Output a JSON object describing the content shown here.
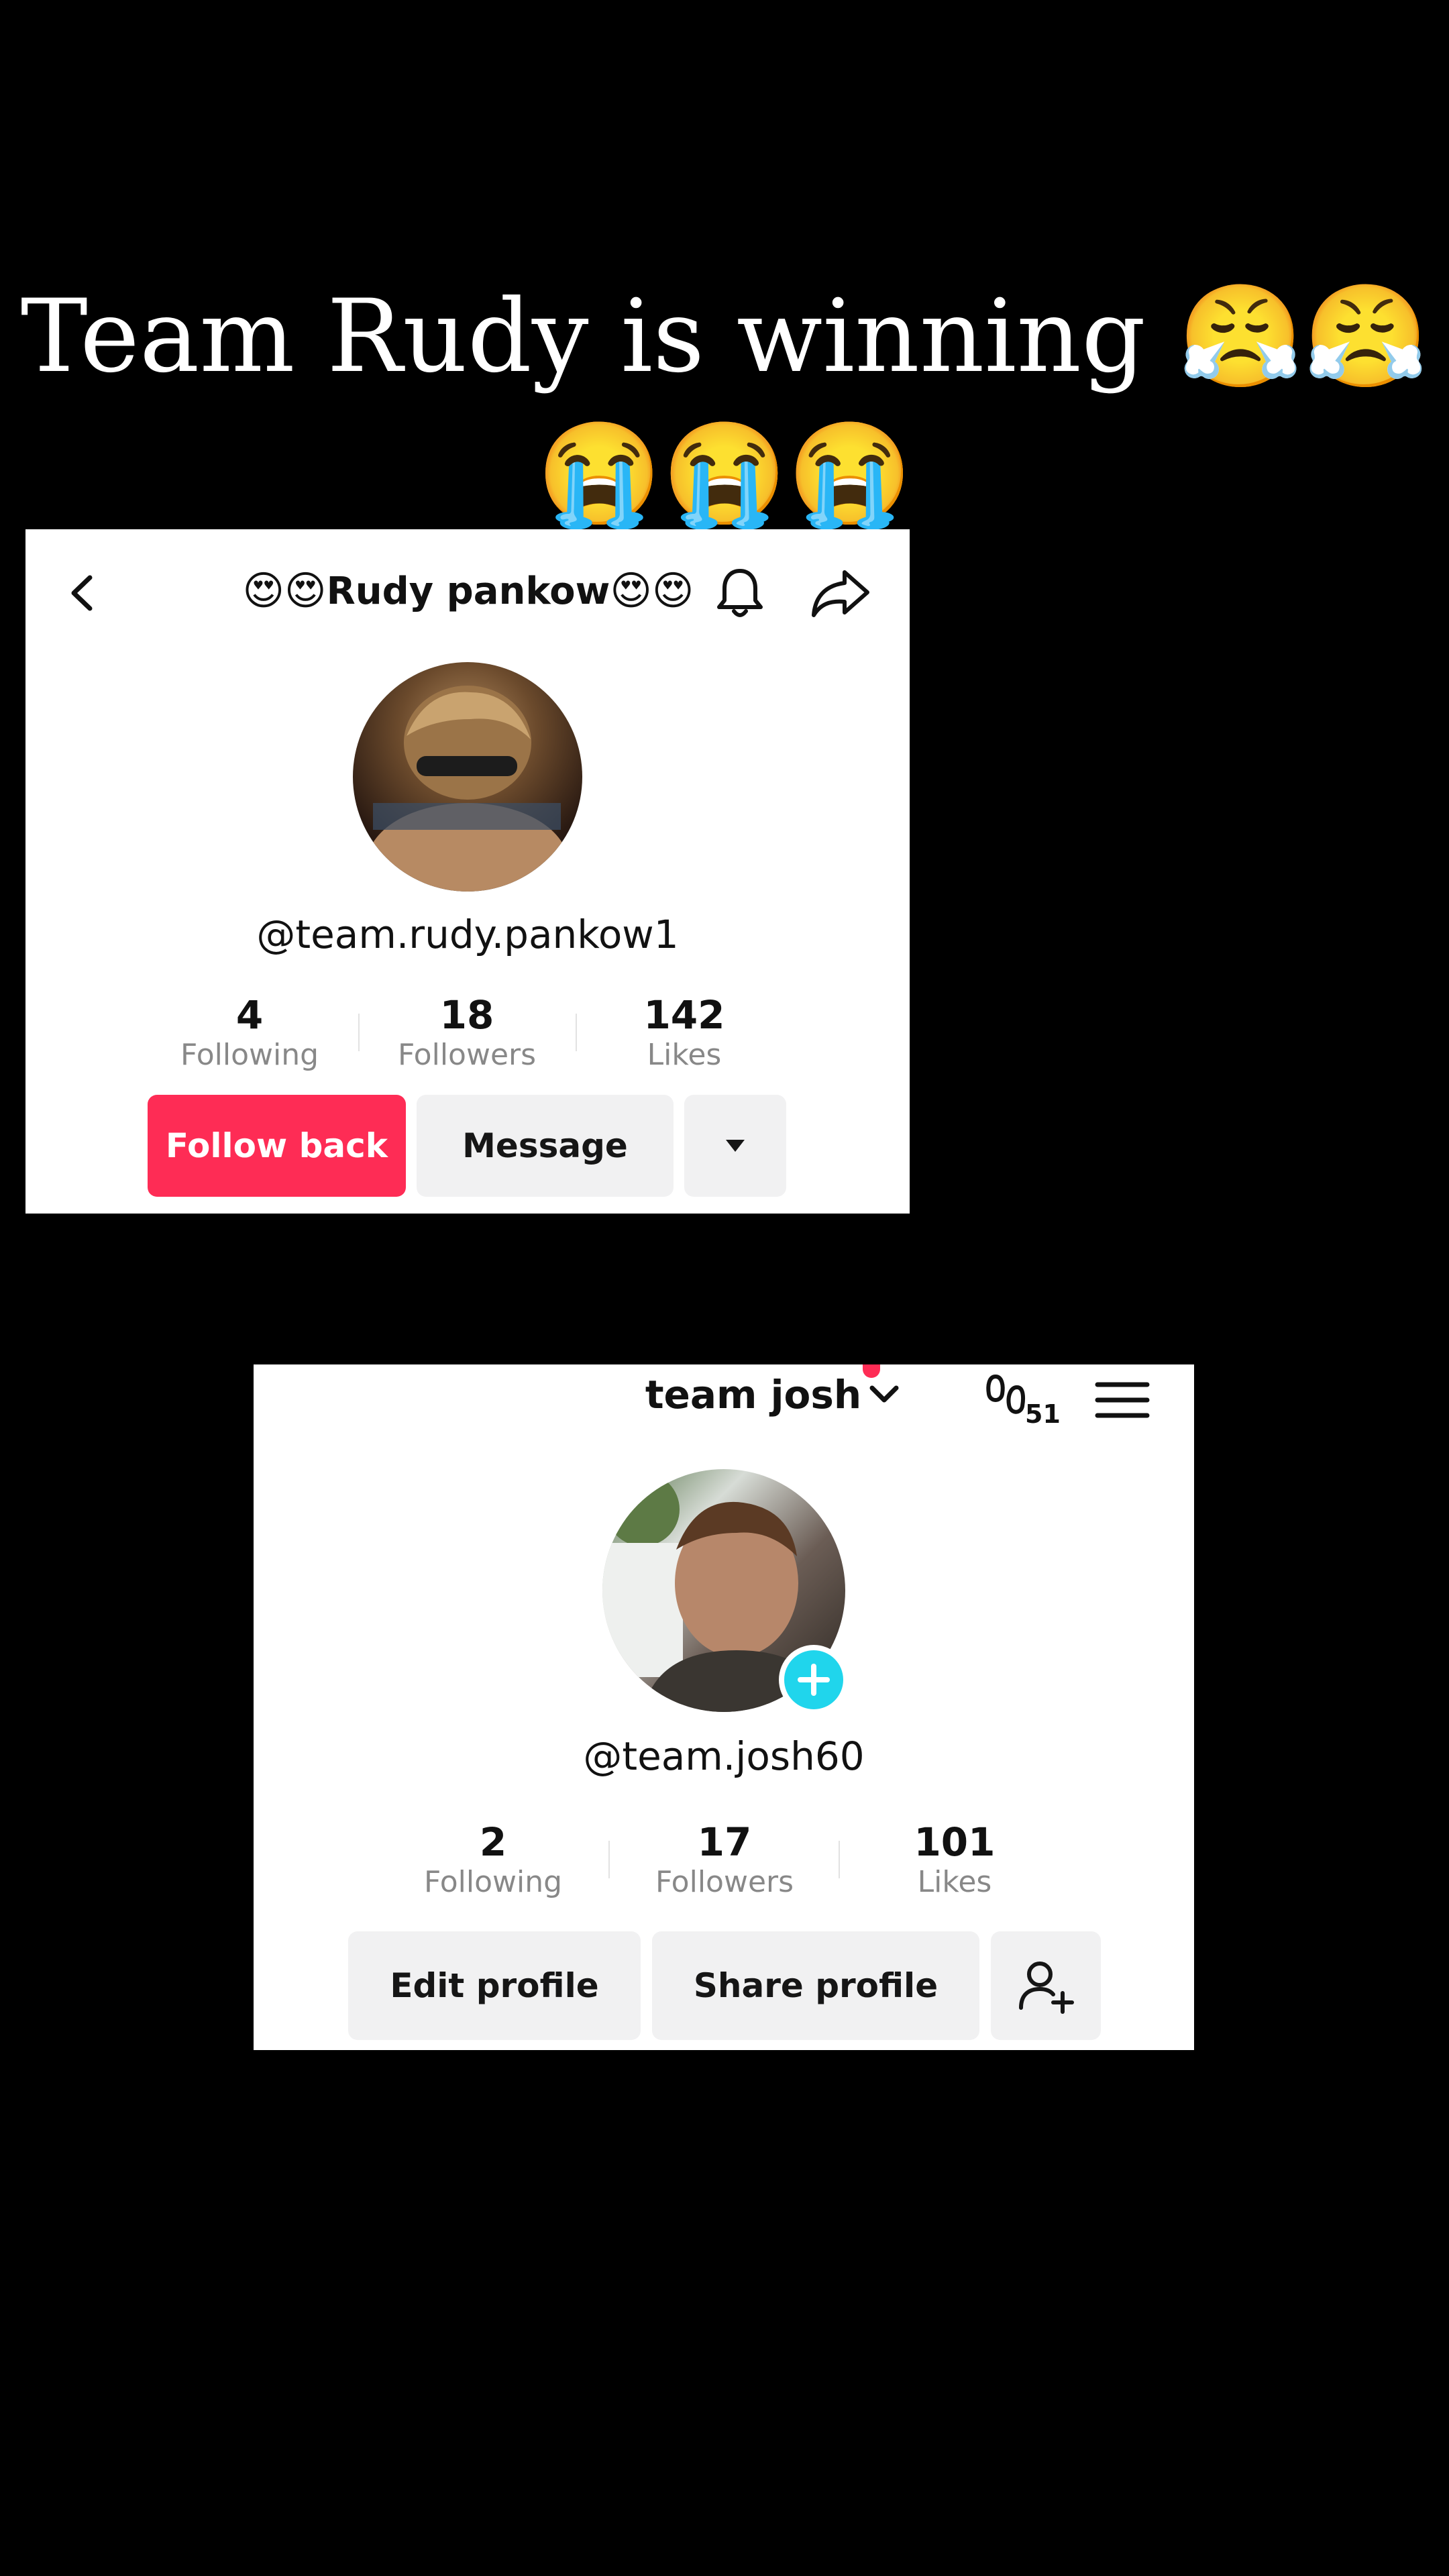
{
  "caption": {
    "line1": "Team Rudy is winning 😤😤",
    "line2": "😭😭😭"
  },
  "profile_rudy": {
    "title_prefix": "😍😍",
    "title_name": "Rudy pankow",
    "title_suffix": "😍😍",
    "handle": "@team.rudy.pankow1",
    "stats": [
      {
        "value": "4",
        "label": "Following"
      },
      {
        "value": "18",
        "label": "Followers"
      },
      {
        "value": "142",
        "label": "Likes"
      }
    ],
    "buttons": {
      "primary": "Follow back",
      "secondary": "Message"
    },
    "icons": [
      "back-chevron-icon",
      "bell-icon",
      "share-arrow-icon",
      "caret-down-icon"
    ],
    "accent_color": "#fe2c55"
  },
  "profile_josh": {
    "account_name": "team josh",
    "footprint_count": "51",
    "handle": "@team.josh60",
    "stats": [
      {
        "value": "2",
        "label": "Following"
      },
      {
        "value": "17",
        "label": "Followers"
      },
      {
        "value": "101",
        "label": "Likes"
      }
    ],
    "buttons": {
      "edit": "Edit profile",
      "share": "Share profile"
    },
    "icons": [
      "chevron-down-icon",
      "footprint-icon",
      "menu-icon",
      "plus-icon",
      "add-friend-icon"
    ],
    "add_badge_color": "#20d5ec",
    "notification_dot_color": "#fe2c55"
  }
}
